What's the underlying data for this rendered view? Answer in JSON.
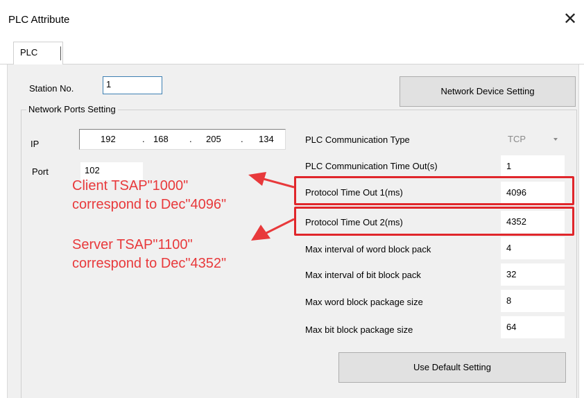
{
  "window": {
    "title": "PLC Attribute",
    "close_glyph": "✕"
  },
  "tabs": [
    {
      "label": "PLC"
    }
  ],
  "station": {
    "label": "Station No.",
    "value": "1"
  },
  "network_device_button": "Network Device Setting",
  "network_group": {
    "title": "Network Ports Setting",
    "ip_label": "IP",
    "ip": [
      "192",
      "168",
      "205",
      "134"
    ],
    "ip_dot": ".",
    "port_label": "Port",
    "port_value": "102"
  },
  "settings": {
    "comm_type": {
      "label": "PLC Communication Type",
      "value": "TCP",
      "icon": "dropdown-arrow"
    },
    "comm_timeout": {
      "label": "PLC Communication Time Out(s)",
      "value": "1"
    },
    "protocol_timeout_1": {
      "label": "Protocol Time Out 1(ms)",
      "value": "4096"
    },
    "protocol_timeout_2": {
      "label": "Protocol Time Out 2(ms)",
      "value": "4352"
    },
    "max_interval_word": {
      "label": "Max interval of word block pack",
      "value": "4"
    },
    "max_interval_bit": {
      "label": "Max interval of bit block pack",
      "value": "32"
    },
    "max_word_size": {
      "label": "Max word block package size",
      "value": "8"
    },
    "max_bit_size": {
      "label": "Max bit block package size",
      "value": "64"
    }
  },
  "default_button": "Use Default Setting",
  "annotations": {
    "client": {
      "line1": "Client TSAP\"1000\"",
      "line2": "correspond to Dec\"4096\""
    },
    "server": {
      "line1": "Server TSAP\"1100\"",
      "line2": "correspond to Dec\"4352\""
    },
    "color": "#e8393b"
  }
}
